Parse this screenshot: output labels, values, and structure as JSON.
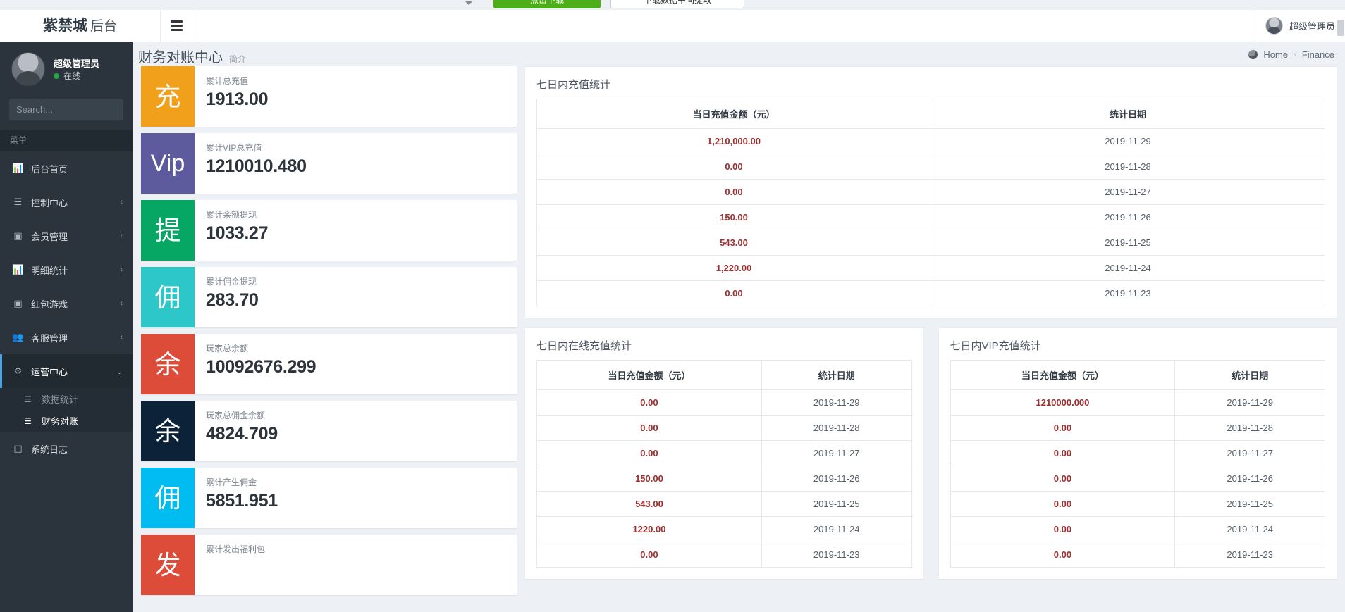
{
  "browser_strip": {
    "green_button": "点击下载",
    "white_button": "下载数据中间提取"
  },
  "topbar": {
    "brand_main": "紫禁城",
    "brand_sub": "后台",
    "hamburger_icon": "hamburger-icon",
    "user_name": "超级管理员"
  },
  "sidebar": {
    "profile": {
      "name": "超级管理员",
      "status": "在线"
    },
    "search": {
      "placeholder": "Search...",
      "value": "",
      "icon": "search-icon"
    },
    "menu_header": "菜单",
    "items": [
      {
        "label": "后台首页",
        "icon": "bar-chart-icon",
        "arrow": ""
      },
      {
        "label": "控制中心",
        "icon": "list-icon",
        "arrow": "‹"
      },
      {
        "label": "会员管理",
        "icon": "user-badge-icon",
        "arrow": "‹"
      },
      {
        "label": "明细统计",
        "icon": "bar-chart-icon",
        "arrow": "‹"
      },
      {
        "label": "红包游戏",
        "icon": "gift-box-icon",
        "arrow": "‹"
      },
      {
        "label": "客服管理",
        "icon": "users-icon",
        "arrow": "‹"
      },
      {
        "label": "运营中心",
        "icon": "rocket-icon",
        "arrow": "⌄"
      }
    ],
    "submenu": [
      {
        "label": "数据统计",
        "icon": "lines-icon",
        "active": false
      },
      {
        "label": "财务对账",
        "icon": "lines-icon",
        "active": true
      }
    ],
    "footer_item": {
      "label": "系统日志",
      "icon": "database-icon"
    }
  },
  "page": {
    "title": "财务对账中心",
    "subtitle": "简介",
    "breadcrumb": {
      "icon": "globe-icon",
      "home": "Home",
      "separator": "›",
      "current": "Finance"
    }
  },
  "stat_cards": [
    {
      "glyph": "充",
      "color": "#f0a01b",
      "label": "累计总充值",
      "value": "1913.00"
    },
    {
      "glyph": "Vip",
      "color": "#5e5a9e",
      "label": "累计VIP总充值",
      "value": "1210010.480"
    },
    {
      "glyph": "提",
      "color": "#06a664",
      "label": "累计余额提现",
      "value": "1033.27"
    },
    {
      "glyph": "佣",
      "color": "#2ec7c9",
      "label": "累计佣金提现",
      "value": "283.70"
    },
    {
      "glyph": "余",
      "color": "#dd4b39",
      "label": "玩家总余额",
      "value": "10092676.299"
    },
    {
      "glyph": "余",
      "color": "#0b2239",
      "label": "玩家总佣金余额",
      "value": "4824.709"
    },
    {
      "glyph": "佣",
      "color": "#00bcf0",
      "label": "累计产生佣金",
      "value": "5851.951"
    },
    {
      "glyph": "发",
      "color": "#dd4b39",
      "label": "累计发出福利包",
      "value": ""
    }
  ],
  "chart_data": [
    {
      "type": "table",
      "title": "七日内充值统计",
      "columns": [
        "当日充值金额（元）",
        "统计日期"
      ],
      "rows": [
        [
          "1,210,000.00",
          "2019-11-29"
        ],
        [
          "0.00",
          "2019-11-28"
        ],
        [
          "0.00",
          "2019-11-27"
        ],
        [
          "150.00",
          "2019-11-26"
        ],
        [
          "543.00",
          "2019-11-25"
        ],
        [
          "1,220.00",
          "2019-11-24"
        ],
        [
          "0.00",
          "2019-11-23"
        ]
      ],
      "categories": [
        "2019-11-29",
        "2019-11-28",
        "2019-11-27",
        "2019-11-26",
        "2019-11-25",
        "2019-11-24",
        "2019-11-23"
      ],
      "values": [
        1210000.0,
        0.0,
        0.0,
        150.0,
        543.0,
        1220.0,
        0.0
      ],
      "xlabel": "统计日期",
      "ylabel": "当日充值金额（元）"
    },
    {
      "type": "table",
      "title": "七日内在线充值统计",
      "columns": [
        "当日充值金额（元）",
        "统计日期"
      ],
      "rows": [
        [
          "0.00",
          "2019-11-29"
        ],
        [
          "0.00",
          "2019-11-28"
        ],
        [
          "0.00",
          "2019-11-27"
        ],
        [
          "150.00",
          "2019-11-26"
        ],
        [
          "543.00",
          "2019-11-25"
        ],
        [
          "1220.00",
          "2019-11-24"
        ],
        [
          "0.00",
          "2019-11-23"
        ]
      ],
      "categories": [
        "2019-11-29",
        "2019-11-28",
        "2019-11-27",
        "2019-11-26",
        "2019-11-25",
        "2019-11-24",
        "2019-11-23"
      ],
      "values": [
        0.0,
        0.0,
        0.0,
        150.0,
        543.0,
        1220.0,
        0.0
      ],
      "xlabel": "统计日期",
      "ylabel": "当日充值金额（元）"
    },
    {
      "type": "table",
      "title": "七日内VIP充值统计",
      "columns": [
        "当日充值金额（元）",
        "统计日期"
      ],
      "rows": [
        [
          "1210000.000",
          "2019-11-29"
        ],
        [
          "0.00",
          "2019-11-28"
        ],
        [
          "0.00",
          "2019-11-27"
        ],
        [
          "0.00",
          "2019-11-26"
        ],
        [
          "0.00",
          "2019-11-25"
        ],
        [
          "0.00",
          "2019-11-24"
        ],
        [
          "0.00",
          "2019-11-23"
        ]
      ],
      "categories": [
        "2019-11-29",
        "2019-11-28",
        "2019-11-27",
        "2019-11-26",
        "2019-11-25",
        "2019-11-24",
        "2019-11-23"
      ],
      "values": [
        1210000.0,
        0.0,
        0.0,
        0.0,
        0.0,
        0.0,
        0.0
      ],
      "xlabel": "统计日期",
      "ylabel": "当日充值金额（元）"
    }
  ]
}
